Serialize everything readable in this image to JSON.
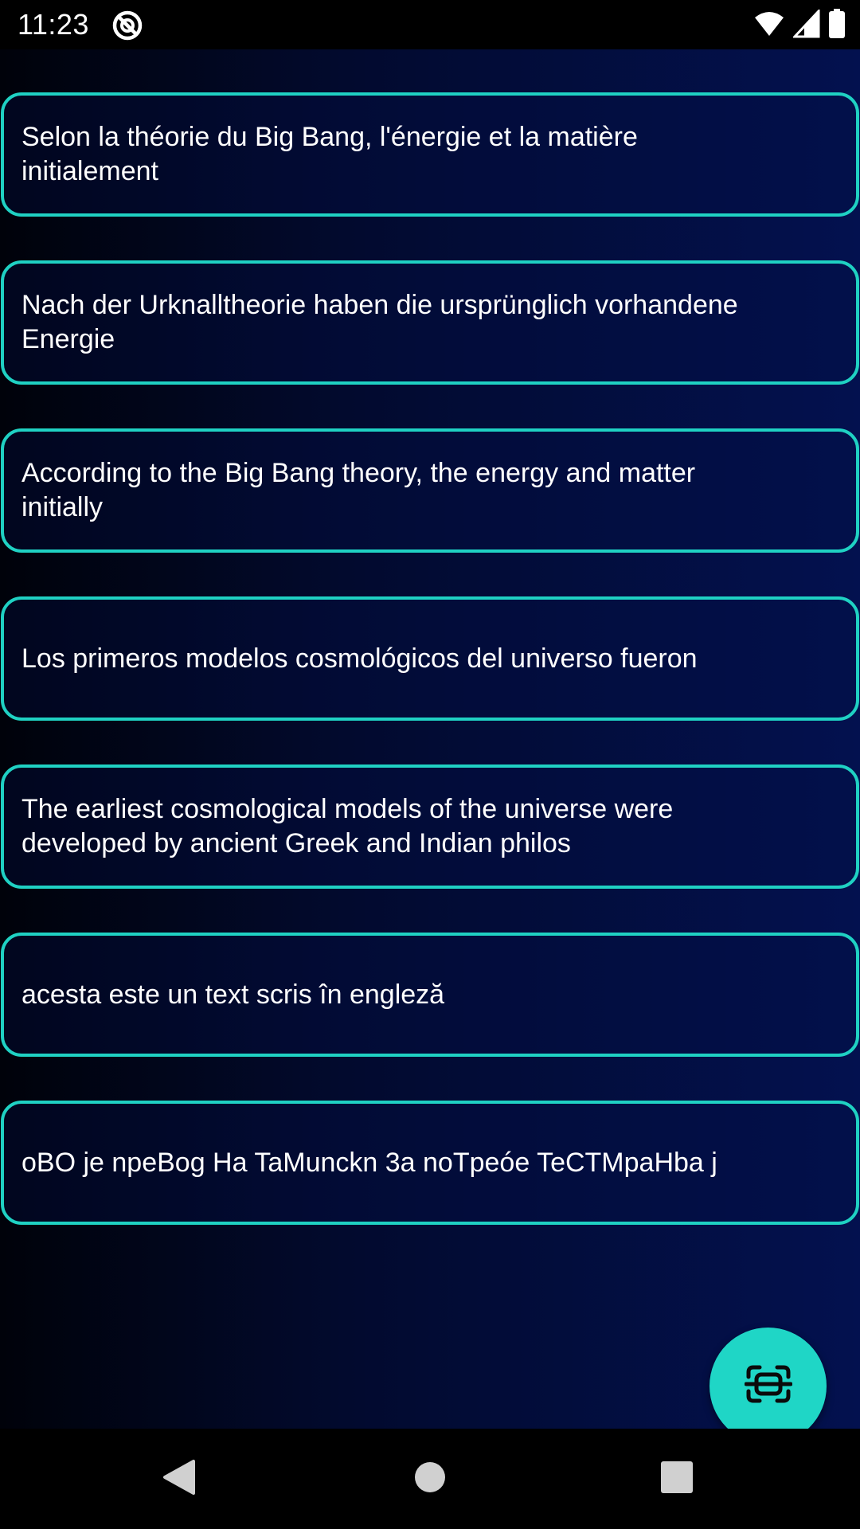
{
  "status_bar": {
    "time": "11:23",
    "icons": [
      "app-notification-icon",
      "wifi-icon",
      "cellular-signal-icon",
      "battery-icon"
    ]
  },
  "cards": [
    {
      "text": "Selon la théorie du Big Bang, l'énergie et la matière initialement"
    },
    {
      "text": "Nach der Urknalltheorie haben die ursprünglich vorhandene Energie"
    },
    {
      "text": "According to the Big Bang theory, the energy and matter initially"
    },
    {
      "text": "Los primeros modelos cosmológicos del universo fueron"
    },
    {
      "text": "The earliest cosmological models of the universe were developed by ancient Greek and Indian philos"
    },
    {
      "text": "acesta este un text scris în engleză"
    },
    {
      "text": "oBO je npeBog Ha TaMunckn 3a noTpeóe TeCTMpaHba j"
    }
  ],
  "fab": {
    "icon": "text-scan-icon"
  },
  "nav_bar": {
    "icons": [
      "back-icon",
      "home-icon",
      "recents-icon"
    ]
  },
  "colors": {
    "accent": "#1fd1c3",
    "background_dark": "#00020a",
    "background_blue": "#03114f",
    "text": "#ffffff"
  }
}
